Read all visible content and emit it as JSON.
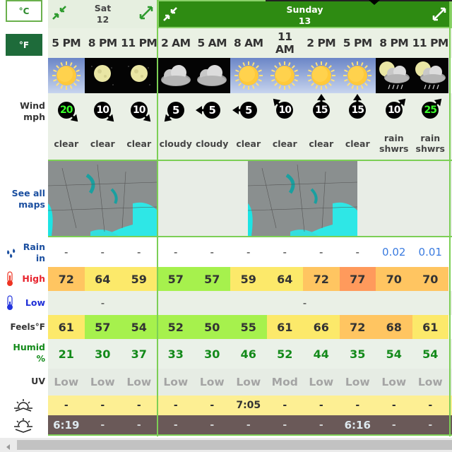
{
  "units": {
    "celsius": "°C",
    "fahrenheit": "°F",
    "active": "fahrenheit"
  },
  "labels": {
    "wind": "Wind",
    "wind_unit": "mph",
    "see_all_maps_line1": "See all",
    "see_all_maps_line2": "maps",
    "rain": "Rain",
    "rain_unit": "in",
    "high": "High",
    "low": "Low",
    "feels": "Feels°F",
    "humid": "Humid",
    "humid_unit": "%",
    "uv": "UV"
  },
  "days": [
    {
      "name": "Sat",
      "date": "12",
      "selected": false
    },
    {
      "name": "Sunday",
      "date": "13",
      "selected": true
    }
  ],
  "times": [
    "5 PM",
    "8 PM",
    "11 PM",
    "2 AM",
    "5 AM",
    "8 AM",
    "11 AM",
    "2 PM",
    "5 PM",
    "8 PM",
    "11 PM"
  ],
  "weather_icons": [
    "sun-icon",
    "moon-icon",
    "moon-icon",
    "cloud-icon",
    "cloud-icon",
    "sun-icon",
    "sun-icon",
    "sun-icon",
    "sun-icon",
    "moon-rain-cloud-icon",
    "moon-rain-cloud-icon"
  ],
  "wind": [
    {
      "speed": "20",
      "direction": "SE",
      "strong": true
    },
    {
      "speed": "10",
      "direction": "SE",
      "strong": false
    },
    {
      "speed": "10",
      "direction": "SE",
      "strong": false
    },
    {
      "speed": "5",
      "direction": "SW",
      "strong": false
    },
    {
      "speed": "5",
      "direction": "W",
      "strong": false
    },
    {
      "speed": "5",
      "direction": "W",
      "strong": false
    },
    {
      "speed": "10",
      "direction": "NW",
      "strong": false
    },
    {
      "speed": "15",
      "direction": "N",
      "strong": false
    },
    {
      "speed": "15",
      "direction": "N",
      "strong": false
    },
    {
      "speed": "10",
      "direction": "NE",
      "strong": false
    },
    {
      "speed": "25",
      "direction": "NE",
      "strong": true
    }
  ],
  "conditions": [
    "clear",
    "clear",
    "clear",
    "cloudy",
    "cloudy",
    "clear",
    "clear",
    "clear",
    "clear",
    "rain shwrs",
    "rain shwrs"
  ],
  "rain": [
    "-",
    "-",
    "-",
    "-",
    "-",
    "-",
    "-",
    "-",
    "-",
    "0.02",
    "0.01"
  ],
  "high": [
    "72",
    "64",
    "59",
    "57",
    "57",
    "59",
    "64",
    "72",
    "77",
    "70",
    "70"
  ],
  "high_colors": [
    "#ffc561",
    "#fce96a",
    "#fce96a",
    "#a6f14d",
    "#a6f14d",
    "#fce96a",
    "#fce96a",
    "#ffc561",
    "#ff9a5c",
    "#ffc561",
    "#ffc561"
  ],
  "low": {
    "sat": "-",
    "sun": "-"
  },
  "feels": [
    "61",
    "57",
    "54",
    "52",
    "50",
    "55",
    "61",
    "66",
    "72",
    "68",
    "61"
  ],
  "feels_colors": [
    "#fce96a",
    "#a6f14d",
    "#a6f14d",
    "#a6f14d",
    "#a6f14d",
    "#a6f14d",
    "#fce96a",
    "#fce96a",
    "#ffc561",
    "#ffc561",
    "#fce96a"
  ],
  "humidity": [
    "21",
    "30",
    "37",
    "33",
    "30",
    "46",
    "52",
    "44",
    "35",
    "54",
    "54"
  ],
  "uv": [
    "Low",
    "Low",
    "Low",
    "Low",
    "Low",
    "Low",
    "Mod",
    "Low",
    "Low",
    "Low",
    "Low"
  ],
  "sunrise": [
    "-",
    "-",
    "-",
    "-",
    "-",
    "7:05",
    "-",
    "-",
    "-",
    "-",
    "-"
  ],
  "sunset": [
    "6:19",
    "-",
    "-",
    "-",
    "-",
    "-",
    "-",
    "-",
    "6:16",
    "-",
    "-"
  ]
}
